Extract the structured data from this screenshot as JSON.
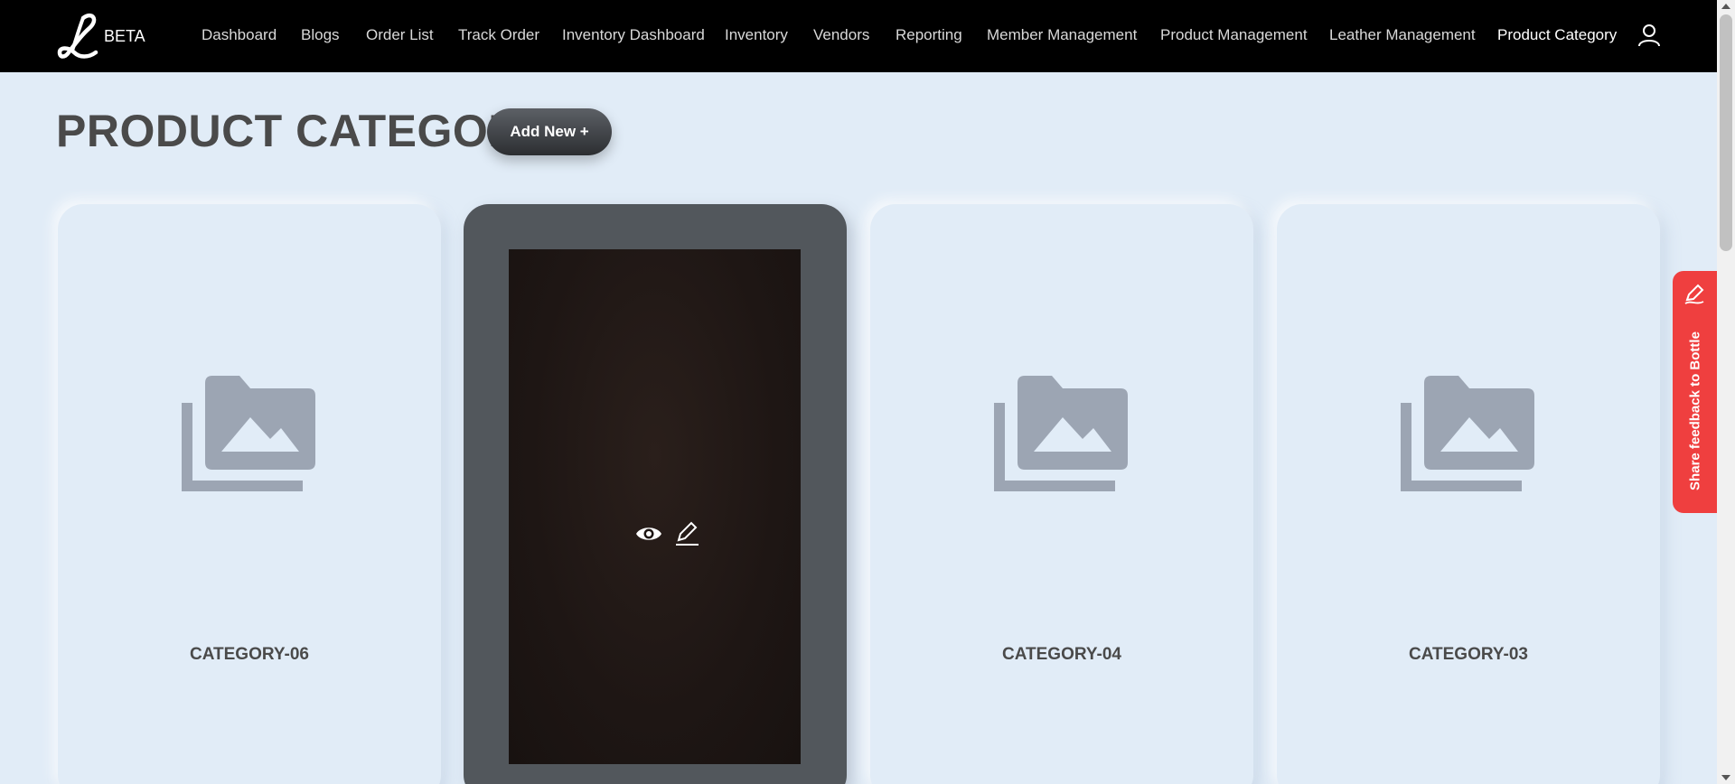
{
  "brand": {
    "badge": "BETA"
  },
  "nav": {
    "items": [
      {
        "label": "Dashboard"
      },
      {
        "label": "Blogs"
      },
      {
        "label": "Order List"
      },
      {
        "label": "Track Order"
      },
      {
        "label": "Inventory Dashboard"
      },
      {
        "label": "Inventory"
      },
      {
        "label": "Vendors"
      },
      {
        "label": "Reporting"
      },
      {
        "label": "Member Management"
      },
      {
        "label": "Product Management"
      },
      {
        "label": "Leather Management"
      },
      {
        "label": "Product Category"
      }
    ],
    "active": "Product Category"
  },
  "page": {
    "title": "PRODUCT CATEGORY",
    "add_button": "Add New +"
  },
  "cards": [
    {
      "label": "CATEGORY-06"
    },
    {
      "label": ""
    },
    {
      "label": "CATEGORY-04"
    },
    {
      "label": "CATEGORY-03"
    }
  ],
  "feedback": {
    "label": "Share feedback to Bottle"
  },
  "colors": {
    "nav_bg": "#000000",
    "page_bg": "#e1ecf7",
    "feedback_bg": "#ef3f3f",
    "dark_card": "#52575c"
  }
}
